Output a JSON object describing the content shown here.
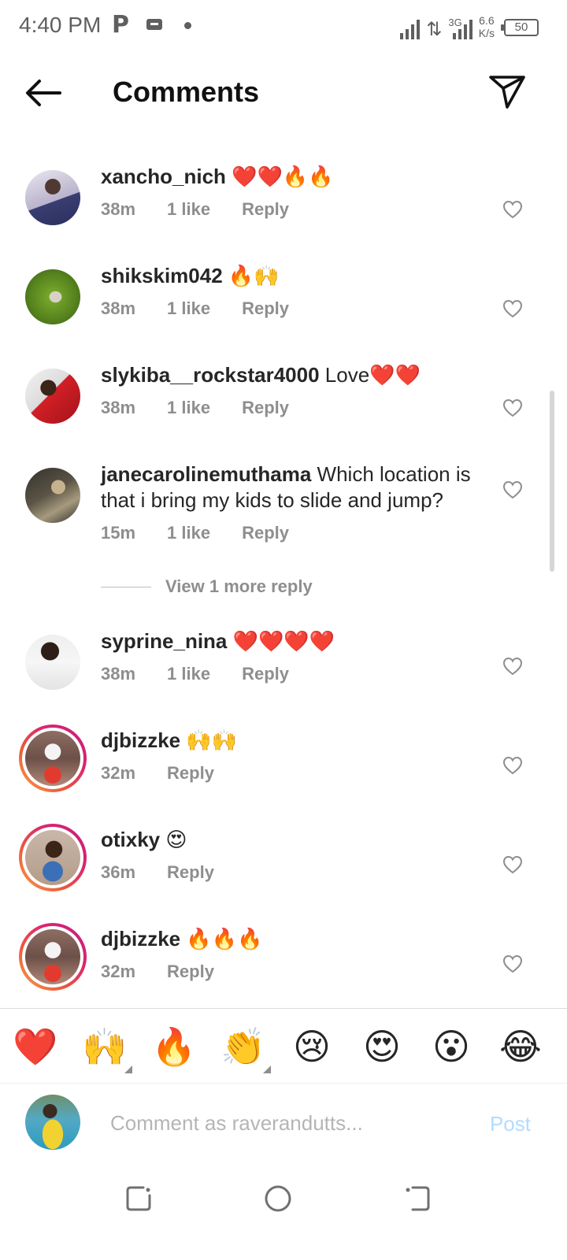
{
  "status_bar": {
    "time": "4:40 PM",
    "network_type": "3G",
    "speed_value": "6.6",
    "speed_unit": "K/s",
    "battery": "50"
  },
  "header": {
    "title": "Comments"
  },
  "comments": [
    {
      "username": "xancho_nich",
      "text": " ❤️❤️🔥🔥",
      "time": "38m",
      "likes": "1 like",
      "reply": "Reply"
    },
    {
      "username": "shikskim042",
      "text": " 🔥🙌",
      "time": "38m",
      "likes": "1 like",
      "reply": "Reply"
    },
    {
      "username": "slykiba__rockstar4000",
      "text": " Love❤️❤️",
      "time": "38m",
      "likes": "1 like",
      "reply": "Reply"
    },
    {
      "username": "janecarolinemuthama",
      "text": " Which location is that i bring my kids to slide and jump?",
      "time": "15m",
      "likes": "1 like",
      "reply": "Reply"
    },
    {
      "username": "syprine_nina",
      "text": " ❤️❤️❤️❤️",
      "time": "38m",
      "likes": "1 like",
      "reply": "Reply"
    },
    {
      "username": "djbizzke",
      "text": " 🙌🙌",
      "time": "32m",
      "reply": "Reply"
    },
    {
      "username": "otixky",
      "text": " 😍",
      "time": "36m",
      "reply": "Reply"
    },
    {
      "username": "djbizzke",
      "text": " 🔥🔥🔥",
      "time": "32m",
      "reply": "Reply"
    }
  ],
  "view_more_reply": "View 1 more reply",
  "emoji_bar": [
    "❤️",
    "🙌",
    "🔥",
    "👏",
    "😢",
    "😍",
    "😮",
    "😂"
  ],
  "composer": {
    "placeholder": "Comment as raverandutts...",
    "post_label": "Post"
  },
  "colors": {
    "text": "#262626",
    "secondary": "#8e8e8e",
    "post_disabled": "#b3dbff",
    "story_ring": "#d9266f"
  }
}
